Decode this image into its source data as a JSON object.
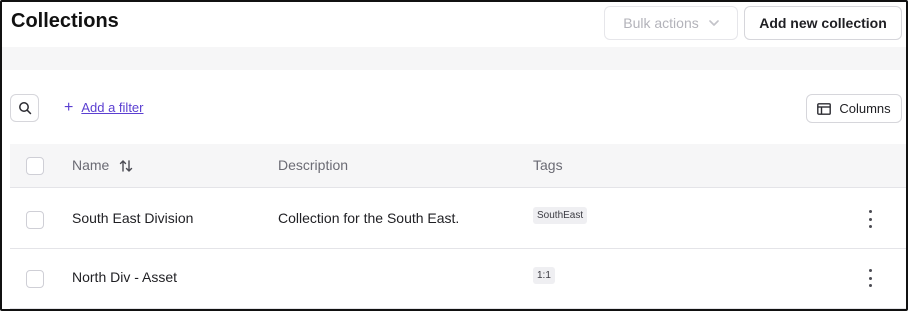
{
  "header": {
    "title": "Collections",
    "bulk_actions_label": "Bulk actions",
    "add_collection_label": "Add new collection"
  },
  "toolbar": {
    "add_filter_label": "Add a filter",
    "columns_label": "Columns"
  },
  "table": {
    "columns": [
      "Name",
      "Description",
      "Tags"
    ],
    "rows": [
      {
        "name": "South East Division",
        "description": "Collection for the South East.",
        "tag": "SouthEast"
      },
      {
        "name": "North Div - Asset",
        "description": "",
        "tag": "1:1"
      }
    ]
  },
  "icons": {
    "search": "search-icon",
    "plus": "plus-icon",
    "chevron": "chevron-down-icon",
    "columns": "table-columns-icon",
    "sort": "sort-icon",
    "more": "more-vertical-icon"
  },
  "colors": {
    "accent": "#5b3fd1",
    "header_bg": "#f6f6f7",
    "border": "#d6d6db"
  }
}
